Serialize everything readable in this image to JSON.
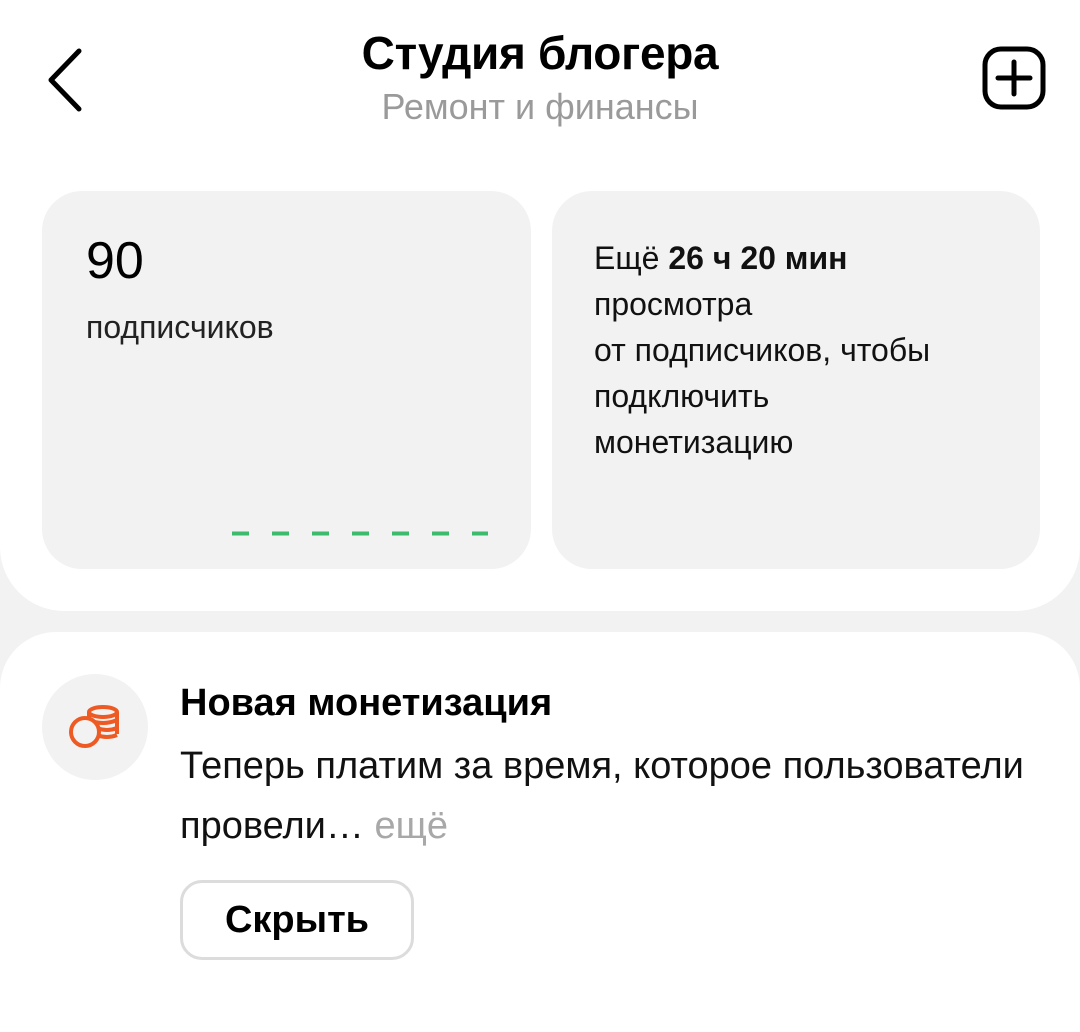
{
  "header": {
    "title": "Студия блогера",
    "subtitle": "Ремонт и финансы",
    "back_icon": "chevron-left-icon",
    "add_icon": "plus-square-icon"
  },
  "stats": {
    "subscribers_count": "90",
    "subscribers_label": "подписчиков",
    "progress_color": "#3dbb6c"
  },
  "monetization_progress": {
    "prefix": "Ещё",
    "remaining_time": "26 ч 20 мин",
    "line1": "просмотра",
    "line2": "от подписчиков, чтобы",
    "line3": "подключить",
    "line4": "монетизацию"
  },
  "notice": {
    "icon": "coins-icon",
    "icon_color": "#ee5a24",
    "title": "Новая монетизация",
    "body": "Теперь платим за время, которое пользователи провели…",
    "more_label": "ещё",
    "hide_button": "Скрыть"
  }
}
